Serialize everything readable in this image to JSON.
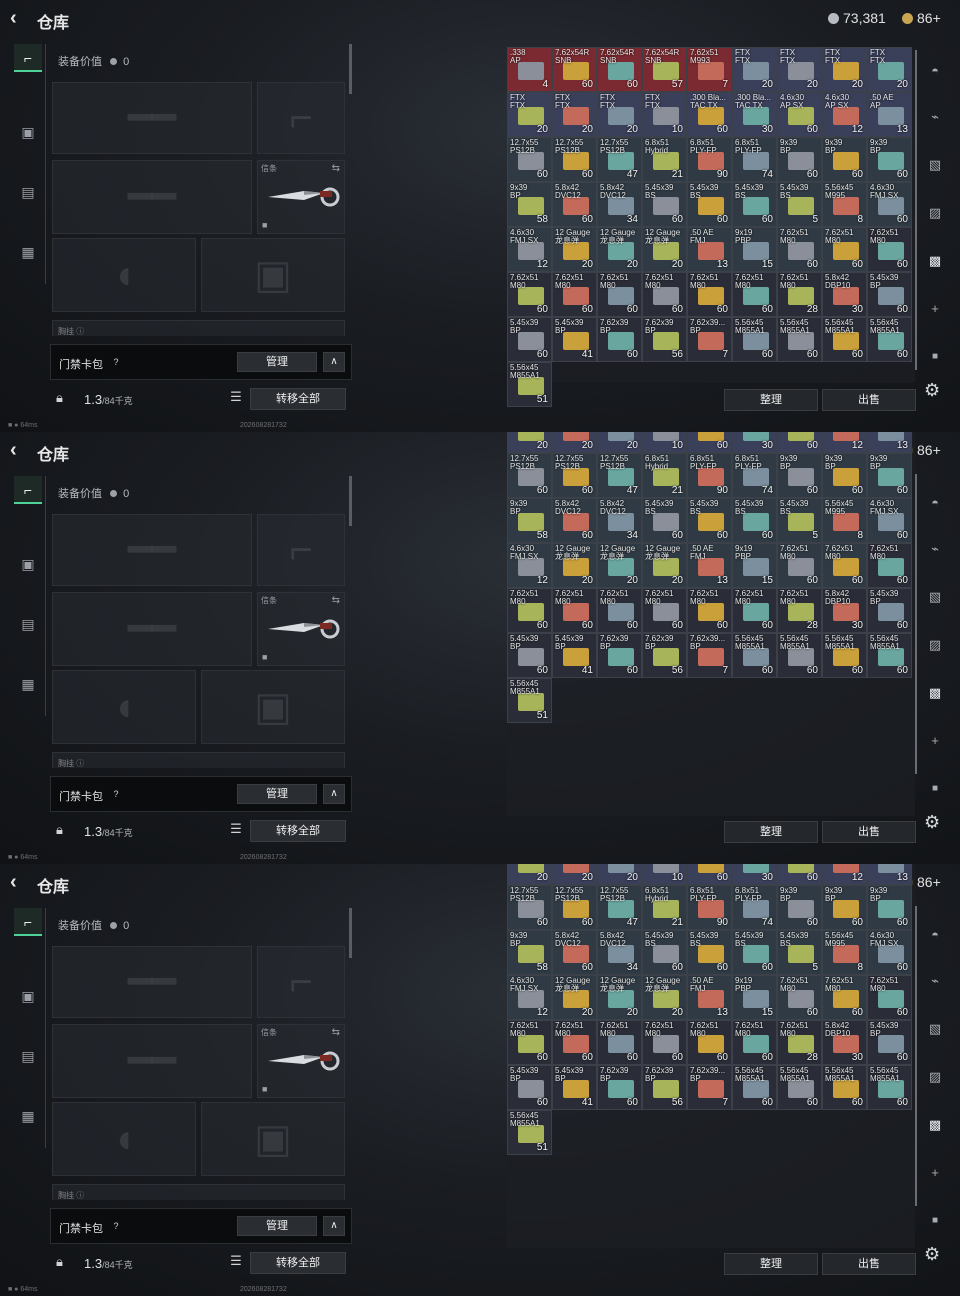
{
  "topbar": {
    "title": "仓库",
    "back_icon": "chevron-left-icon",
    "currency": "73,381",
    "currency_color": "#b8bcc2",
    "bonds": "86+",
    "bonds_color": "#c9a451"
  },
  "equipment": {
    "value_label": "装备价值",
    "value": "0",
    "melee_label": "信条",
    "pocket_label": "胸挂"
  },
  "card": {
    "label": "门禁卡包",
    "help": "?",
    "manage": "管理"
  },
  "footer": {
    "weight": "1.3",
    "weight_cap": "/84千克",
    "transfer_all": "转移全部",
    "sort": "整理",
    "sell": "出售"
  },
  "status": {
    "ping": "64ms",
    "build": "202608281732"
  },
  "accent": "#4fd19a",
  "panels": [
    {
      "scroll_offset": 0
    },
    {
      "scroll_offset": 1
    },
    {
      "scroll_offset": 1
    }
  ],
  "items": [
    {
      "name": ".338\nAP",
      "qty": "4",
      "color": "#7a2a30"
    },
    {
      "name": "7.62x54R\nSNB",
      "qty": "60",
      "color": "#7a2a30"
    },
    {
      "name": "7.62x54R\nSNB",
      "qty": "60",
      "color": "#7a2a30"
    },
    {
      "name": "7.62x54R\nSNB",
      "qty": "57",
      "color": "#7a2a30"
    },
    {
      "name": "7.62x51\nM993",
      "qty": "7",
      "color": "#7a2a30"
    },
    {
      "name": "FTX\nFTX",
      "qty": "20",
      "color": "#3a3f5a"
    },
    {
      "name": "FTX\nFTX",
      "qty": "20",
      "color": "#3a3f5a"
    },
    {
      "name": "FTX\nFTX",
      "qty": "20",
      "color": "#3a3f5a"
    },
    {
      "name": "FTX\nFTX",
      "qty": "20",
      "color": "#3a3f5a"
    },
    {
      "name": "FTX\nFTX",
      "qty": "20",
      "color": "#3a3f5a"
    },
    {
      "name": "FTX\nFTX",
      "qty": "20",
      "color": "#3a3f5a"
    },
    {
      "name": "FTX\nFTX",
      "qty": "20",
      "color": "#3a3f5a"
    },
    {
      "name": "FTX\nFTX",
      "qty": "10",
      "color": "#3a3f5a"
    },
    {
      "name": ".300 Bla...\nTAC TX",
      "qty": "60",
      "color": "#3a3f5a"
    },
    {
      "name": ".300 Bla...\nTAC TX",
      "qty": "30",
      "color": "#3a3f5a"
    },
    {
      "name": "4.6x30\nAP SX",
      "qty": "60",
      "color": "#3a3f5a"
    },
    {
      "name": "4.6x30\nAP SX",
      "qty": "12",
      "color": "#3a3f5a"
    },
    {
      "name": ".50 AE\nAP",
      "qty": "13",
      "color": "#3a3f5a"
    },
    {
      "name": "12.7x55\nPS12B",
      "qty": "60",
      "color": "#2f3a44"
    },
    {
      "name": "12.7x55\nPS12B",
      "qty": "60",
      "color": "#2f3a44"
    },
    {
      "name": "12.7x55\nPS12B",
      "qty": "47",
      "color": "#2f3a44"
    },
    {
      "name": "6.8x51\nHybrid",
      "qty": "21",
      "color": "#2f3a44"
    },
    {
      "name": "6.8x51\nPLY-FP",
      "qty": "90",
      "color": "#2f3a44"
    },
    {
      "name": "6.8x51\nPLY-FP",
      "qty": "74",
      "color": "#2f3a44"
    },
    {
      "name": "9x39\nBP",
      "qty": "60",
      "color": "#2f3a44"
    },
    {
      "name": "9x39\nBP",
      "qty": "60",
      "color": "#2f3a44"
    },
    {
      "name": "9x39\nBP",
      "qty": "60",
      "color": "#2f3a44"
    },
    {
      "name": "9x39\nBP",
      "qty": "58",
      "color": "#2f3a44"
    },
    {
      "name": "5.8x42\nDVC12",
      "qty": "60",
      "color": "#2f3a44"
    },
    {
      "name": "5.8x42\nDVC12",
      "qty": "34",
      "color": "#2f3a44"
    },
    {
      "name": "5.45x39\nBS",
      "qty": "60",
      "color": "#2f3a44"
    },
    {
      "name": "5.45x39\nBS",
      "qty": "60",
      "color": "#2f3a44"
    },
    {
      "name": "5.45x39\nBS",
      "qty": "60",
      "color": "#2f3a44"
    },
    {
      "name": "5.45x39\nBS",
      "qty": "5",
      "color": "#2f3a44"
    },
    {
      "name": "5.56x45\nM995",
      "qty": "8",
      "color": "#2f3a44"
    },
    {
      "name": "4.6x30\nFMJ SX",
      "qty": "60",
      "color": "#2f3a44"
    },
    {
      "name": "4.6x30\nFMJ SX",
      "qty": "12",
      "color": "#2f3a44"
    },
    {
      "name": "12 Gauge\n龙息弹",
      "qty": "20",
      "color": "#2f3a44"
    },
    {
      "name": "12 Gauge\n龙息弹",
      "qty": "20",
      "color": "#2f3a44"
    },
    {
      "name": "12 Gauge\n龙息弹",
      "qty": "20",
      "color": "#2f3a44"
    },
    {
      "name": ".50 AE\nFMJ",
      "qty": "13",
      "color": "#2f3a44"
    },
    {
      "name": "9x19\nPBP",
      "qty": "15",
      "color": "#2f3a44"
    },
    {
      "name": "7.62x51\nM80",
      "qty": "60",
      "color": "#2f3a44"
    },
    {
      "name": "7.62x51\nM80",
      "qty": "60",
      "color": "#2f3a44"
    },
    {
      "name": "7.62x51\nM80",
      "qty": "60",
      "color": "#2a2d38"
    },
    {
      "name": "7.62x51\nM80",
      "qty": "60",
      "color": "#2a2d38"
    },
    {
      "name": "7.62x51\nM80",
      "qty": "60",
      "color": "#2a2d38"
    },
    {
      "name": "7.62x51\nM80",
      "qty": "60",
      "color": "#2a2d38"
    },
    {
      "name": "7.62x51\nM80",
      "qty": "60",
      "color": "#2a2d38"
    },
    {
      "name": "7.62x51\nM80",
      "qty": "60",
      "color": "#2a2d38"
    },
    {
      "name": "7.62x51\nM80",
      "qty": "60",
      "color": "#2a2d38"
    },
    {
      "name": "7.62x51\nM80",
      "qty": "28",
      "color": "#2a2d38"
    },
    {
      "name": "5.8x42\nDBP10",
      "qty": "30",
      "color": "#2a2d38"
    },
    {
      "name": "5.45x39\nBP",
      "qty": "60",
      "color": "#2a2d38"
    },
    {
      "name": "5.45x39\nBP",
      "qty": "60",
      "color": "#2a2d38"
    },
    {
      "name": "5.45x39\nBP",
      "qty": "41",
      "color": "#2a2d38"
    },
    {
      "name": "7.62x39\nBP",
      "qty": "60",
      "color": "#2a2d38"
    },
    {
      "name": "7.62x39\nBP",
      "qty": "56",
      "color": "#2a2d38"
    },
    {
      "name": "7.62x39...\nBP",
      "qty": "7",
      "color": "#2a2d38"
    },
    {
      "name": "5.56x45\nM855A1",
      "qty": "60",
      "color": "#2a2d38"
    },
    {
      "name": "5.56x45\nM855A1",
      "qty": "60",
      "color": "#2a2d38"
    },
    {
      "name": "5.56x45\nM855A1",
      "qty": "60",
      "color": "#2a2d38"
    },
    {
      "name": "5.56x45\nM855A1",
      "qty": "60",
      "color": "#2a2d38"
    },
    {
      "name": "5.56x45\nM855A1",
      "qty": "51",
      "color": "#2a2d38"
    }
  ]
}
